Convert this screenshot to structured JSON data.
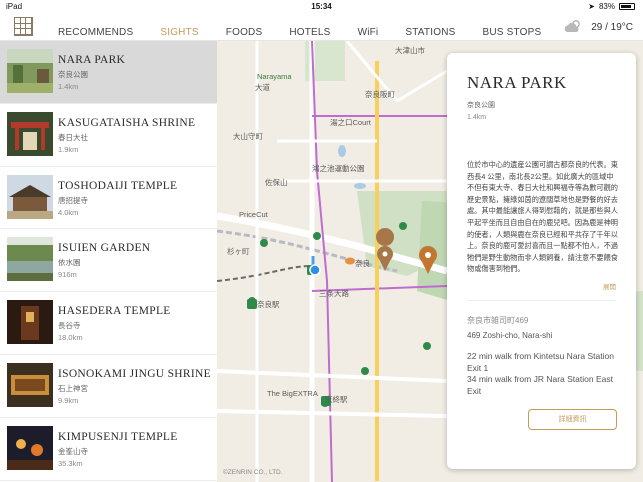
{
  "status": {
    "carrier": "iPad",
    "time": "15:34",
    "battery": "83%"
  },
  "nav": {
    "tabs": [
      {
        "label": "RECOMMENDS"
      },
      {
        "label": "SIGHTS"
      },
      {
        "label": "FOODS"
      },
      {
        "label": "HOTELS"
      },
      {
        "label": "WiFi"
      },
      {
        "label": "STATIONS"
      },
      {
        "label": "BUS STOPS"
      }
    ],
    "active_tab": "SIGHTS",
    "weather": "29 / 19°C"
  },
  "sights": [
    {
      "name": "NARA PARK",
      "jp": "奈良公園",
      "dist": "1.4km"
    },
    {
      "name": "KASUGATAISHA SHRINE",
      "jp": "春日大社",
      "dist": "1.9km"
    },
    {
      "name": "TOSHODAIJI TEMPLE",
      "jp": "唐招提寺",
      "dist": "4.0km"
    },
    {
      "name": "ISUIEN GARDEN",
      "jp": "依水園",
      "dist": "916m"
    },
    {
      "name": "HASEDERA TEMPLE",
      "jp": "長谷寺",
      "dist": "18.0km"
    },
    {
      "name": "ISONOKAMI JINGU SHRINE",
      "jp": "石上神宮",
      "dist": "9.9km"
    },
    {
      "name": "KIMPUSENJI TEMPLE",
      "jp": "金峯山寺",
      "dist": "35.3km"
    }
  ],
  "map": {
    "labels": {
      "narayama": "Narayama",
      "daido": "大道",
      "narazaka": "奈良阪町",
      "nara_jr_kindergarten": "奈良阪町東",
      "oyama": "大山守町",
      "konishi": "小西町",
      "jsmu": "大津山市",
      "court": "湯之口Court",
      "rengoku": "奈良市役所",
      "undo": "鴻之池運動公園",
      "sahoyama": "佐保山",
      "pricecut": "PriceCut",
      "sakai": "杉ヶ町",
      "nara_station": "奈良駅",
      "kintetsu": "奈良",
      "sanjo": "三条大路",
      "bigextra": "The BigEXTRA",
      "kyobate": "京終駅",
      "sodaiji": "東大寺",
      "zenrin": "©ZENRIN CO., LTD."
    }
  },
  "detail": {
    "title": "NARA PARK",
    "jp": "奈良公園",
    "dist": "1.4km",
    "description": "位於市中心的遺産公園可謂古都奈良的代表。東西長4 公里，南北長2公里。如此廣大的區域中不但有東大寺、春日大社和興福寺等為數可觀的歷史景點，擁綠如茵的遼闊草地也是野餐的好去處。其中最能讓旅人得到慰藉的，就是那些與人平起平坐而且自由自在的鹿兒吧。因為鹿是神明的使者，人類與鹿在奈良已經和平共存了千年以上。奈良的鹿可愛討喜而且一點都不怕人，不過牠們是野生動物而非人類飼養，請注意不要餵食物或傷害到牠們。",
    "more": "展開",
    "address_jp": "奈良市雑司町469",
    "address_en": "469 Zoshi-cho, Nara-shi",
    "access": "22 min walk from Kintetsu Nara Station Exit 1\n34 min walk from JR Nara Station East Exit",
    "detail_button": "詳細資訊"
  }
}
